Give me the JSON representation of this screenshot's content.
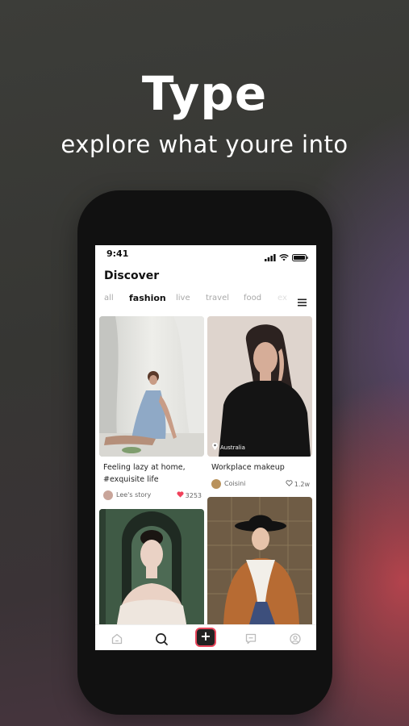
{
  "promo": {
    "title": "Type",
    "subtitle": "explore what youre into"
  },
  "status_bar": {
    "time": "9:41"
  },
  "page": {
    "title": "Discover"
  },
  "tabs": [
    {
      "label": "all"
    },
    {
      "label": "fashion",
      "active": true
    },
    {
      "label": "live"
    },
    {
      "label": "travel"
    },
    {
      "label": "food"
    },
    {
      "label": "ex"
    }
  ],
  "feed": [
    {
      "title_line1": "Feeling lazy at home,",
      "title_line2": "#exquisite life",
      "author": "Lee's story",
      "likes": "3253",
      "liked": true
    },
    {
      "location": "Australia",
      "title_line1": "Workplace makeup",
      "author": "Coisini",
      "likes": "1.2w",
      "liked": false
    },
    {},
    {}
  ],
  "bottom_nav": {
    "add_label": "+",
    "items": [
      "home-icon",
      "search-icon",
      "add-icon",
      "message-icon",
      "profile-icon"
    ]
  },
  "colors": {
    "accent": "#e8465b",
    "heart": "#f0415a"
  }
}
